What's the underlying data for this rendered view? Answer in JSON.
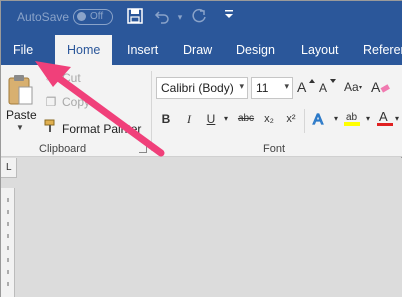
{
  "title_bar": {
    "autosave_label": "AutoSave",
    "autosave_state": "Off",
    "icons": [
      "save-icon",
      "undo-icon",
      "undo-dropdown-icon",
      "redo-icon",
      "customize-qat-icon"
    ]
  },
  "tabs": [
    {
      "label": "File",
      "active": false
    },
    {
      "label": "Home",
      "active": true
    },
    {
      "label": "Insert",
      "active": false
    },
    {
      "label": "Draw",
      "active": false
    },
    {
      "label": "Design",
      "active": false
    },
    {
      "label": "Layout",
      "active": false
    },
    {
      "label": "Referen",
      "active": false
    }
  ],
  "clipboard": {
    "paste_label": "Paste",
    "cut_label": "Cut",
    "copy_label": "Copy",
    "format_painter_label": "Format Painter",
    "group_label": "Clipboard"
  },
  "font": {
    "family_value": "Calibri (Body)",
    "size_value": "11",
    "bold_glyph": "B",
    "italic_glyph": "I",
    "underline_glyph": "U",
    "strikethrough_glyph": "abc",
    "subscript_glyph": "x₂",
    "superscript_glyph": "x²",
    "group_label": "Font"
  },
  "ruler_corner_glyph": "L",
  "colors": {
    "word_blue": "#2b579a",
    "ribbon_bg": "#f3f3f3",
    "arrow": "#f0407a",
    "font_color_red": "#e02020",
    "highlight_yellow": "#ffff00"
  }
}
